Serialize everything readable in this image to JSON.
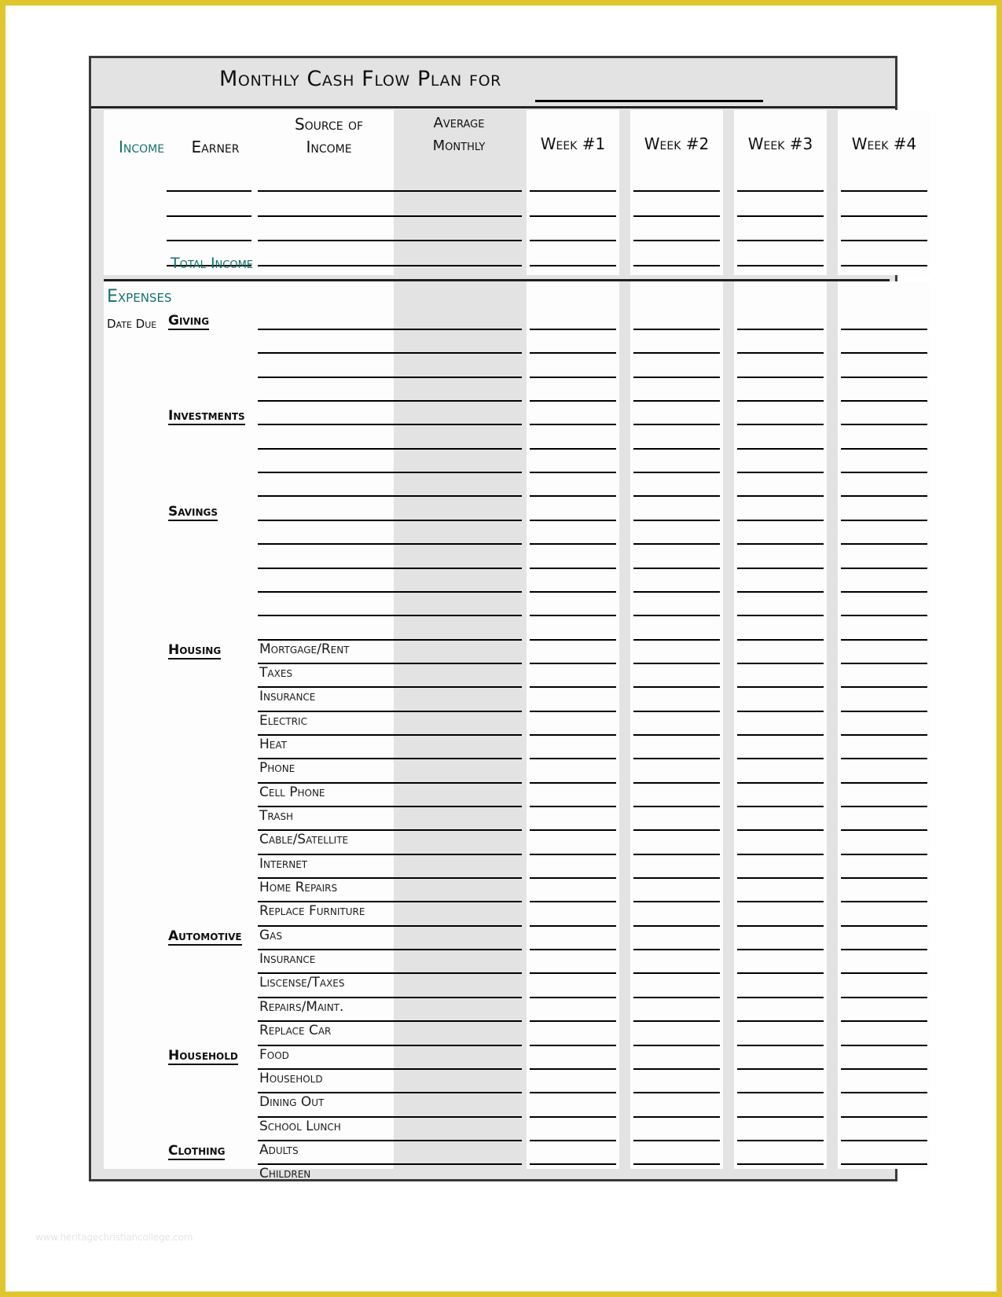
{
  "document": {
    "title": "Monthly Cash Flow Plan for",
    "watermark": "www.heritagechristiancollege.com",
    "accent_teal": "#15716f",
    "frame_color": "#e0c62e",
    "shade_color": "#e3e3e3"
  },
  "income": {
    "section_label": "Income",
    "columns": {
      "earner": "Earner",
      "source_line1": "Source of",
      "source_line2": "Income",
      "average_line1": "Average",
      "average_line2": "Monthly",
      "week1": "Week #1",
      "week2": "Week #2",
      "week3": "Week #3",
      "week4": "Week #4"
    },
    "blank_rows": 4,
    "total_label": "Total Income"
  },
  "expenses": {
    "section_label": "Expenses",
    "date_due_label": "Date Due",
    "groups": [
      {
        "name": "Giving",
        "items": [],
        "blank_rows": 3
      },
      {
        "name": "Investments",
        "items": [],
        "blank_rows": 3
      },
      {
        "name": "Savings",
        "items": [],
        "blank_rows": 4
      },
      {
        "name": "Housing",
        "items": [
          "Mortgage/Rent",
          "Taxes",
          "Insurance",
          "Electric",
          "Heat",
          "Phone",
          "Cell Phone",
          "Trash",
          "Cable/Satellite",
          "Internet",
          "Home Repairs",
          "Replace Furniture"
        ],
        "blank_rows": 0
      },
      {
        "name": "Automotive",
        "items": [
          "Gas",
          "Insurance",
          "Liscense/Taxes",
          "Repairs/Maint.",
          "Replace Car"
        ],
        "blank_rows": 0
      },
      {
        "name": "Household",
        "items": [
          "Food",
          "Household",
          "Dining Out",
          "School Lunch"
        ],
        "blank_rows": 0
      },
      {
        "name": "Clothing",
        "items": [
          "Adults",
          "Children"
        ],
        "blank_rows": 0
      }
    ]
  }
}
